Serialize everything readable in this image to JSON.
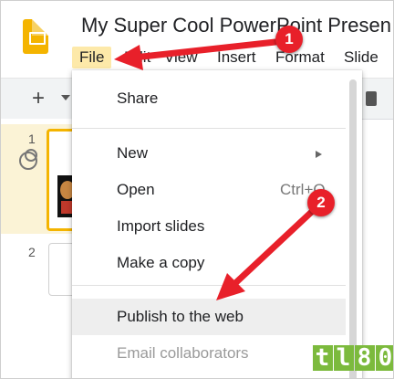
{
  "app": {
    "doc_title": "My Super Cool PowerPoint Presen",
    "logo_icon": "google-slides-logo"
  },
  "menubar": {
    "items": [
      "File",
      "Edit",
      "View",
      "Insert",
      "Format",
      "Slide"
    ],
    "active": "File",
    "active_color": "#fde9a9"
  },
  "toolbar": {
    "new_icon": "plus-icon",
    "caret_icon": "chevron-down-icon"
  },
  "filmstrip": {
    "slides": [
      {
        "number": "1",
        "selected": true
      },
      {
        "number": "2",
        "selected": false
      }
    ],
    "selected_border_color": "#f4b400"
  },
  "file_menu": {
    "items": [
      {
        "label": "Share"
      },
      {
        "label": "New",
        "submenu": true
      },
      {
        "label": "Open",
        "shortcut": "Ctrl+O"
      },
      {
        "label": "Import slides"
      },
      {
        "label": "Make a copy"
      },
      {
        "label": "Publish to the web",
        "highlighted": true
      },
      {
        "label": "Email collaborators",
        "disabled": true
      }
    ]
  },
  "annotations": {
    "step_1": "1",
    "step_2": "2",
    "arrow_color": "#e8202a"
  },
  "watermark": {
    "text": "tl80",
    "color": "#7cba3d"
  }
}
